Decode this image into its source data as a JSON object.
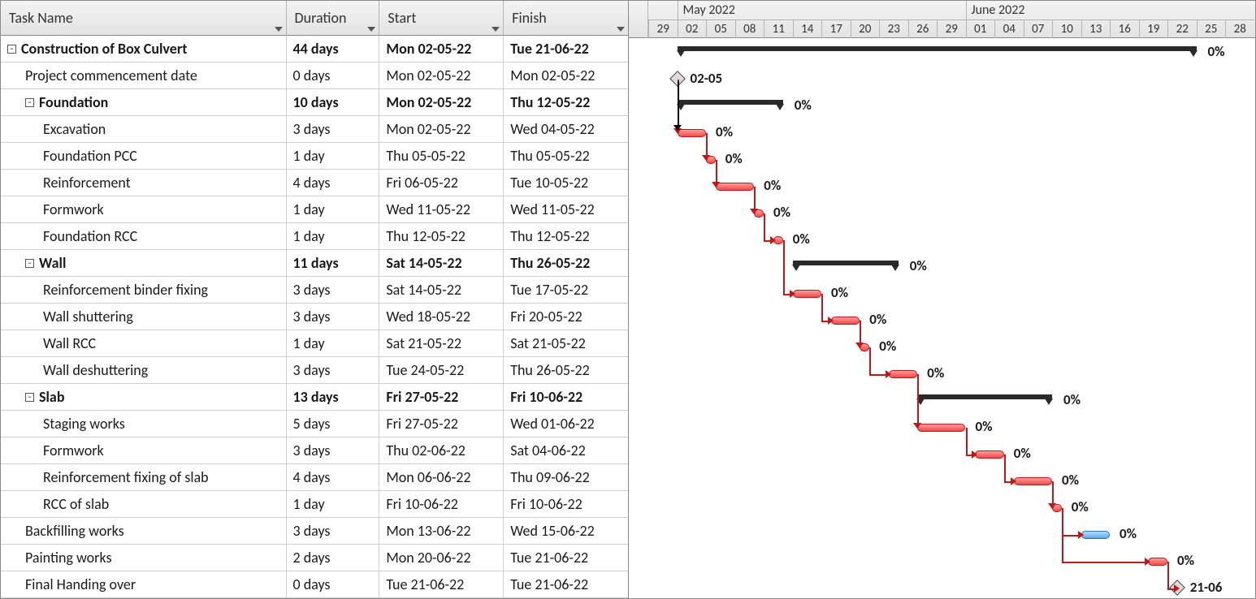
{
  "columns": {
    "name": "Task Name",
    "duration": "Duration",
    "start": "Start",
    "finish": "Finish"
  },
  "timescale": {
    "months": [
      {
        "label": "May 2022",
        "col": 1
      },
      {
        "label": "June 2022",
        "col": 11
      }
    ],
    "days": [
      "29",
      "02",
      "05",
      "08",
      "11",
      "14",
      "17",
      "20",
      "23",
      "26",
      "29",
      "01",
      "04",
      "07",
      "10",
      "13",
      "16",
      "19",
      "22",
      "25",
      "28"
    ]
  },
  "chart_data": {
    "type": "gantt",
    "day_zero": "29-04-2022",
    "columns_are_3_day_spans_starting_from": "29",
    "progress_unit": "%"
  },
  "rows": [
    {
      "id": "r0",
      "level": 0,
      "bold": true,
      "collapse": "-",
      "name": "Construction of Box Culvert",
      "dur": "44 days",
      "start": "Mon 02-05-22",
      "finish": "Tue 21-06-22",
      "bar": "summary",
      "from": 1,
      "to": 19,
      "label": "0%",
      "label_right": true
    },
    {
      "id": "r1",
      "level": 1,
      "name": "Project commencement date",
      "dur": "0 days",
      "start": "Mon 02-05-22",
      "finish": "Mon 02-05-22",
      "bar": "milestone",
      "from": 1,
      "to": 1,
      "label": "02-05"
    },
    {
      "id": "r2",
      "level": 1,
      "bold": true,
      "collapse": "-",
      "name": "Foundation",
      "dur": "10 days",
      "start": "Mon 02-05-22",
      "finish": "Thu 12-05-22",
      "bar": "summary",
      "from": 1,
      "to": 4.67,
      "label": "0%"
    },
    {
      "id": "r3",
      "level": 2,
      "name": "Excavation",
      "dur": "3 days",
      "start": "Mon 02-05-22",
      "finish": "Wed 04-05-22",
      "bar": "task",
      "from": 1,
      "to": 2,
      "label": "0%",
      "link_prev": "r1"
    },
    {
      "id": "r4",
      "level": 2,
      "name": "Foundation PCC",
      "dur": "1 day",
      "start": "Thu 05-05-22",
      "finish": "Thu 05-05-22",
      "bar": "task",
      "from": 2,
      "to": 2.33,
      "label": "0%",
      "link_prev": "r3"
    },
    {
      "id": "r5",
      "level": 2,
      "name": "Reinforcement",
      "dur": "4 days",
      "start": "Fri 06-05-22",
      "finish": "Tue 10-05-22",
      "bar": "task",
      "from": 2.33,
      "to": 3.67,
      "label": "0%",
      "link_prev": "r4"
    },
    {
      "id": "r6",
      "level": 2,
      "name": "Formwork",
      "dur": "1 day",
      "start": "Wed 11-05-22",
      "finish": "Wed 11-05-22",
      "bar": "task",
      "from": 3.67,
      "to": 4,
      "label": "0%",
      "link_prev": "r5"
    },
    {
      "id": "r7",
      "level": 2,
      "name": "Foundation RCC",
      "dur": "1 day",
      "start": "Thu 12-05-22",
      "finish": "Thu 12-05-22",
      "bar": "task",
      "from": 4.33,
      "to": 4.67,
      "label": "0%",
      "link_prev": "r6"
    },
    {
      "id": "r8",
      "level": 1,
      "bold": true,
      "collapse": "-",
      "name": "Wall",
      "dur": "11 days",
      "start": "Sat 14-05-22",
      "finish": "Thu 26-05-22",
      "bar": "summary",
      "from": 5,
      "to": 8.67,
      "label": "0%"
    },
    {
      "id": "r9",
      "level": 2,
      "name": "Reinforcement binder fixing",
      "dur": "3 days",
      "start": "Sat 14-05-22",
      "finish": "Tue 17-05-22",
      "bar": "task",
      "from": 5,
      "to": 6,
      "label": "0%",
      "link_prev": "r7"
    },
    {
      "id": "r10",
      "level": 2,
      "name": "Wall shuttering",
      "dur": "3 days",
      "start": "Wed 18-05-22",
      "finish": "Fri 20-05-22",
      "bar": "task",
      "from": 6.33,
      "to": 7.33,
      "label": "0%",
      "link_prev": "r9"
    },
    {
      "id": "r11",
      "level": 2,
      "name": "Wall RCC",
      "dur": "1 day",
      "start": "Sat 21-05-22",
      "finish": "Sat 21-05-22",
      "bar": "task",
      "from": 7.33,
      "to": 7.67,
      "label": "0%",
      "link_prev": "r10"
    },
    {
      "id": "r12",
      "level": 2,
      "name": "Wall deshuttering",
      "dur": "3 days",
      "start": "Tue 24-05-22",
      "finish": "Thu 26-05-22",
      "bar": "task",
      "from": 8.33,
      "to": 9.33,
      "label": "0%",
      "link_prev": "r11"
    },
    {
      "id": "r13",
      "level": 1,
      "bold": true,
      "collapse": "-",
      "name": "Slab",
      "dur": "13 days",
      "start": "Fri 27-05-22",
      "finish": "Fri 10-06-22",
      "bar": "summary",
      "from": 9.33,
      "to": 14,
      "label": "0%"
    },
    {
      "id": "r14",
      "level": 2,
      "name": "Staging works",
      "dur": "5 days",
      "start": "Fri 27-05-22",
      "finish": "Wed 01-06-22",
      "bar": "task",
      "from": 9.33,
      "to": 11,
      "label": "0%",
      "link_prev": "r12"
    },
    {
      "id": "r15",
      "level": 2,
      "name": "Formwork",
      "dur": "3 days",
      "start": "Thu 02-06-22",
      "finish": "Sat 04-06-22",
      "bar": "task",
      "from": 11.33,
      "to": 12.33,
      "label": "0%",
      "link_prev": "r14"
    },
    {
      "id": "r16",
      "level": 2,
      "name": "Reinforcement fixing of slab",
      "dur": "4 days",
      "start": "Mon 06-06-22",
      "finish": "Thu 09-06-22",
      "bar": "task",
      "from": 12.67,
      "to": 14,
      "label": "0%",
      "link_prev": "r15"
    },
    {
      "id": "r17",
      "level": 2,
      "name": "RCC of slab",
      "dur": "1 day",
      "start": "Fri 10-06-22",
      "finish": "Fri 10-06-22",
      "bar": "task",
      "from": 14,
      "to": 14.33,
      "label": "0%",
      "link_prev": "r16"
    },
    {
      "id": "r18",
      "level": 1,
      "name": "Backfilling works",
      "dur": "3 days",
      "start": "Mon 13-06-22",
      "finish": "Wed 15-06-22",
      "bar": "task",
      "color": "blue",
      "from": 15,
      "to": 16,
      "label": "0%",
      "link_prev": "r17"
    },
    {
      "id": "r19",
      "level": 1,
      "name": "Painting works",
      "dur": "2 days",
      "start": "Mon 20-06-22",
      "finish": "Tue 21-06-22",
      "bar": "task",
      "from": 17.33,
      "to": 18,
      "label": "0%",
      "link_prev": "r17"
    },
    {
      "id": "r20",
      "level": 1,
      "name": "Final Handing over",
      "dur": "0 days",
      "start": "Tue 21-06-22",
      "finish": "Tue 21-06-22",
      "bar": "milestone",
      "from": 18.33,
      "to": 18.33,
      "label": "21-06",
      "link_prev": "r19"
    }
  ]
}
